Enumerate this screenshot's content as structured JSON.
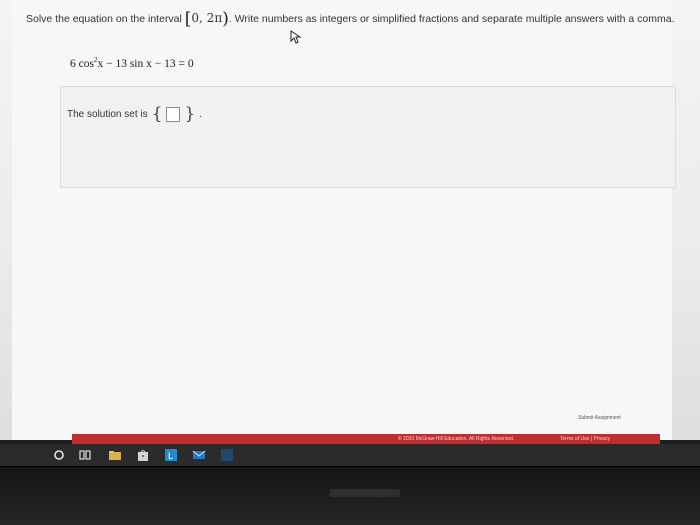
{
  "question": {
    "prompt_before": "Solve the equation on the interval",
    "interval_open": "[",
    "interval_values": "0, 2π",
    "interval_close": ")",
    "prompt_after": ". Write numbers as integers or simplified fractions and separate multiple answers with a comma."
  },
  "equation": {
    "part1": "6 cos",
    "exponent": "2",
    "part2": "x − 13 sin x − 13 = 0"
  },
  "answer": {
    "label": "The solution set is",
    "open_brace": "{",
    "close_brace": "}",
    "value": "",
    "period": "."
  },
  "actions": {
    "submit_label": "Submit Assignment"
  },
  "footer": {
    "copyright": "© 2020 McGraw-Hill Education. All Rights Reserved.",
    "terms": "Terms of Use",
    "separator": "|",
    "privacy": "Privacy"
  },
  "colors": {
    "footer_bar": "#c22d2d",
    "taskbar": "#2b2b2b"
  },
  "taskbar": {
    "icons": [
      "search-circle-icon",
      "task-view-icon",
      "file-explorer-icon",
      "store-icon",
      "launcher-icon",
      "mail-icon",
      "app-icon"
    ]
  }
}
